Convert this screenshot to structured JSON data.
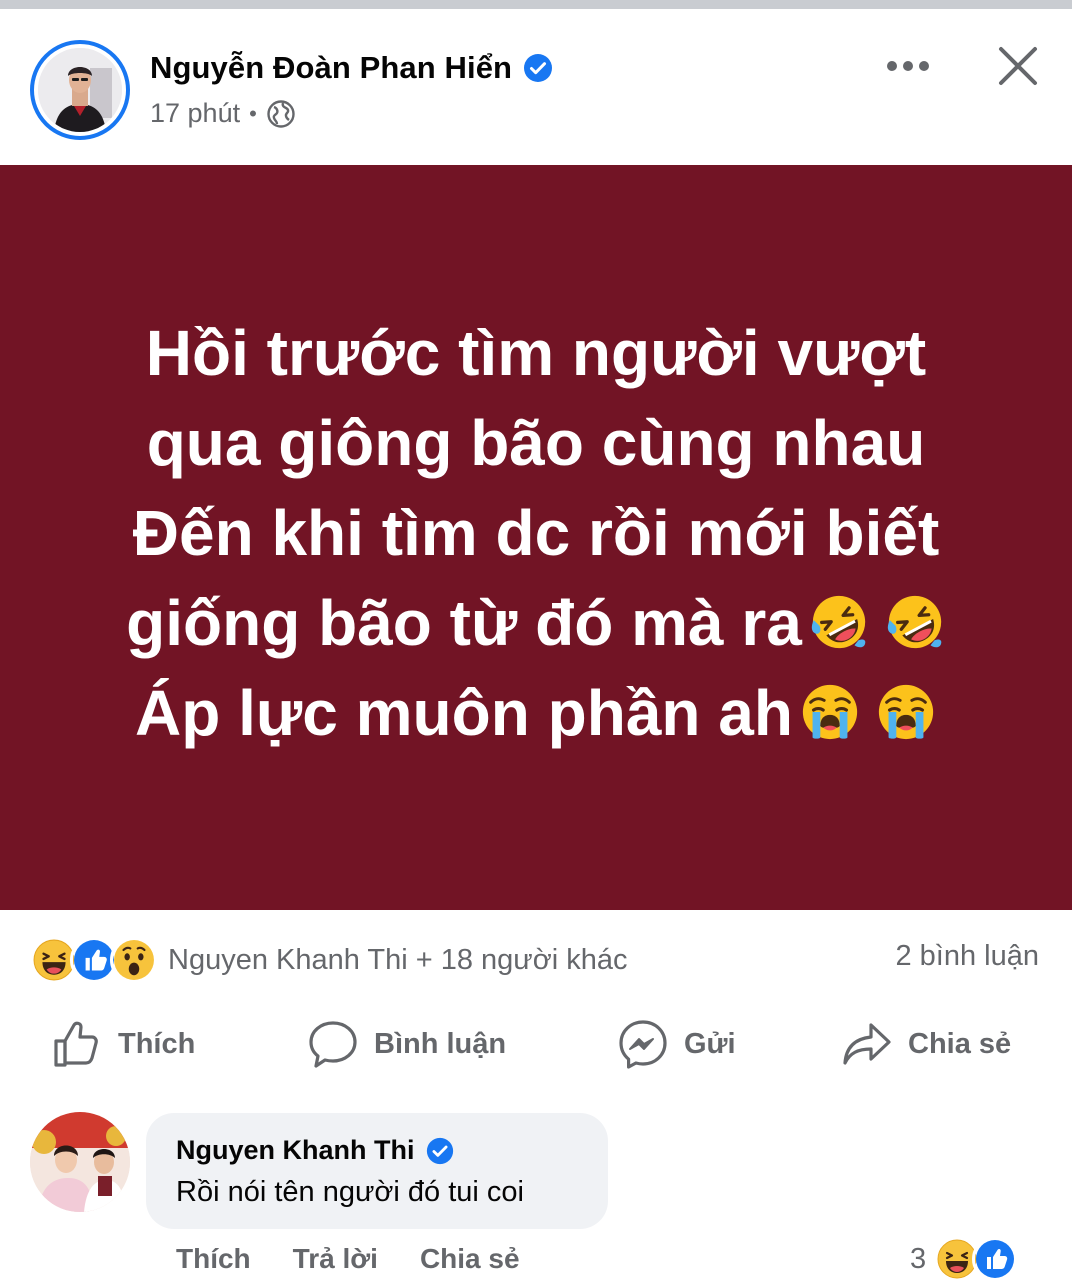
{
  "post": {
    "author": "Nguyễn Đoàn Phan Hiển",
    "time": "17 phút",
    "separator": "•",
    "privacy_icon": "globe-icon",
    "status_lines": [
      "Hồi trước tìm người vượt",
      "qua giông bão cùng nhau",
      "Đến khi tìm dc rồi mới biết",
      "giống bão từ đó mà ra",
      "Áp lực muôn phần ah"
    ],
    "status_bg": "#721425"
  },
  "reactions": {
    "icons": [
      "haha-icon",
      "like-icon",
      "wow-icon"
    ],
    "summary": "Nguyen Khanh Thi + 18 người khác",
    "comments": "2 bình luận"
  },
  "actions": {
    "like": "Thích",
    "comment": "Bình luận",
    "send": "Gửi",
    "share": "Chia sẻ"
  },
  "comment": {
    "author": "Nguyen Khanh Thi",
    "text": "Rồi nói tên người đó tui coi",
    "like": "Thích",
    "reply": "Trả lời",
    "share": "Chia sẻ",
    "reaction_count": "3"
  },
  "colors": {
    "brand_blue": "#1877f2",
    "secondary_text": "#65676b",
    "bubble_bg": "#f0f2f5"
  }
}
